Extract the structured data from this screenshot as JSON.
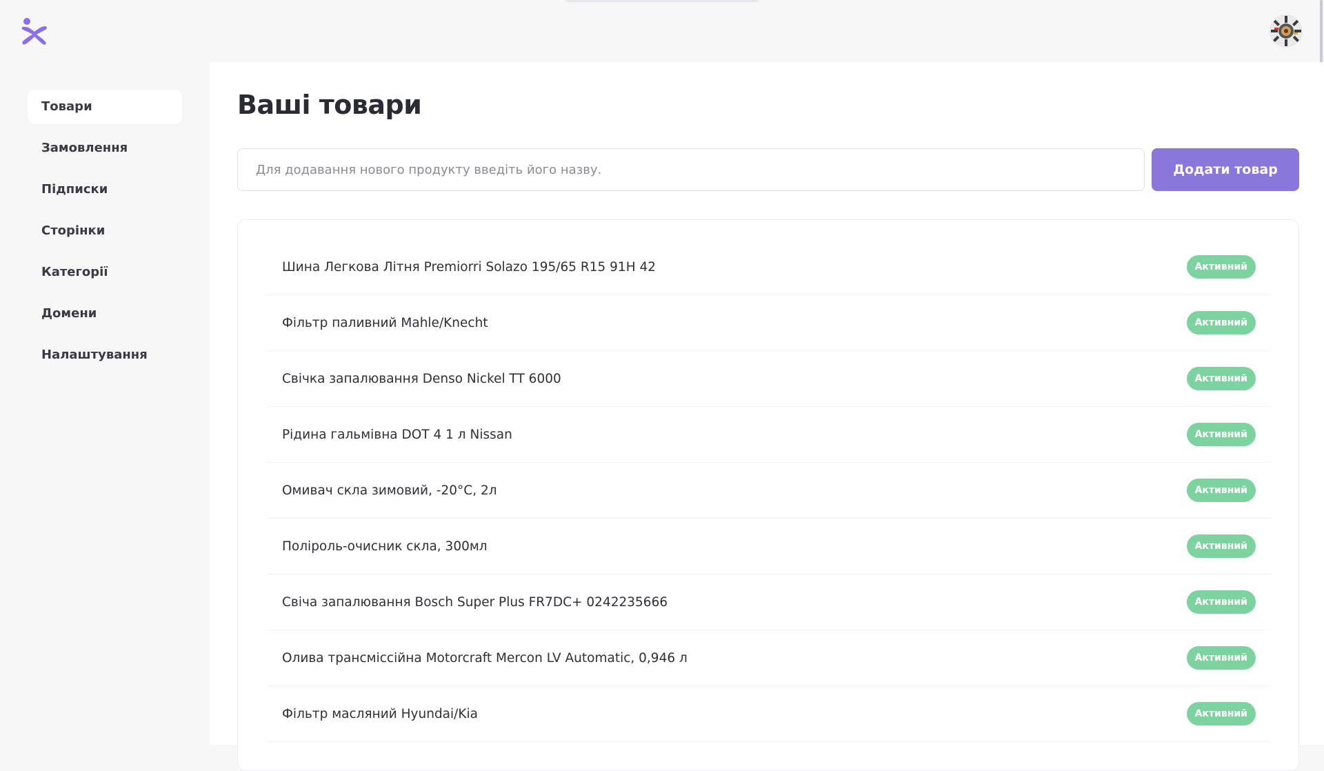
{
  "header": {
    "logo_icon": "asterisk-people-logo",
    "avatar_icon": "user-avatar-icon"
  },
  "sidebar": {
    "items": [
      {
        "label": "Товари",
        "active": true
      },
      {
        "label": "Замовлення",
        "active": false
      },
      {
        "label": "Підписки",
        "active": false
      },
      {
        "label": "Сторінки",
        "active": false
      },
      {
        "label": "Категорії",
        "active": false
      },
      {
        "label": "Домени",
        "active": false
      },
      {
        "label": "Налаштування",
        "active": false
      }
    ]
  },
  "main": {
    "title": "Ваші товари",
    "search": {
      "value": "",
      "placeholder": "Для додавання нового продукту введіть його назву."
    },
    "add_button_label": "Додати товар",
    "products": [
      {
        "name": "Шина Легкова Літня Premiorri Solazo 195/65 R15 91H 42",
        "status": "Активний"
      },
      {
        "name": "Фільтр паливний Mahle/Knecht",
        "status": "Активний"
      },
      {
        "name": "Свічка запалювання Denso Nickel TT 6000",
        "status": "Активний"
      },
      {
        "name": "Рідина гальмівна DOT 4 1 л Nissan",
        "status": "Активний"
      },
      {
        "name": "Омивач скла зимовий, -20°C, 2л",
        "status": "Активний"
      },
      {
        "name": "Поліроль-очисник скла, 300мл",
        "status": "Активний"
      },
      {
        "name": "Свіча запалювання Bosch Super Plus FR7DC+ 0242235666",
        "status": "Активний"
      },
      {
        "name": "Олива трансміссійна Motorcraft Mercon LV Automatic, 0,946 л",
        "status": "Активний"
      },
      {
        "name": "Фільтр масляний Hyundai/Kia",
        "status": "Активний"
      }
    ]
  },
  "colors": {
    "accent": "#8b76dc",
    "status_active": "#7dd3a0",
    "background": "#f7f7f8",
    "panel": "#ffffff"
  }
}
